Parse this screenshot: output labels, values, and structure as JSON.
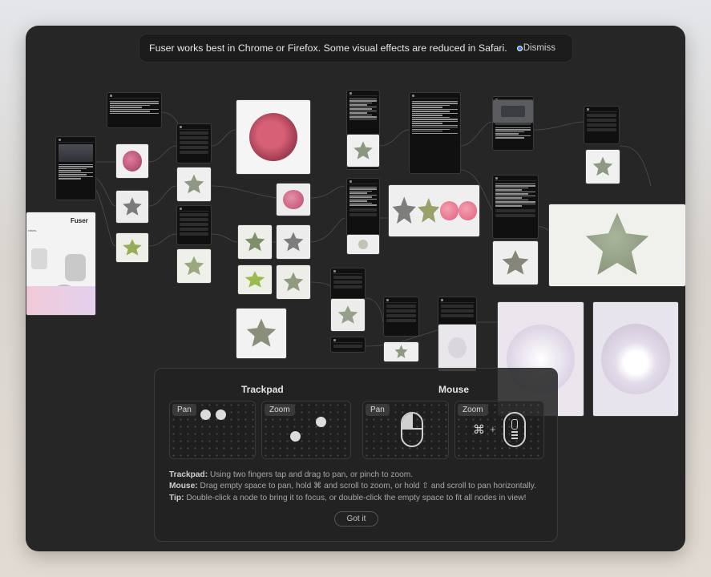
{
  "banner": {
    "message": "Fuser works best in Chrome or Firefox. Some visual effects are reduced in Safari.",
    "icons": [
      "chrome-icon",
      "firefox-icon"
    ],
    "dismiss_label": "Dismiss"
  },
  "canvas": {
    "landing_card": {
      "brand": "Fuser",
      "snippet": "rators."
    }
  },
  "help": {
    "trackpad_title": "Trackpad",
    "mouse_title": "Mouse",
    "pan_label": "Pan",
    "zoom_label": "Zoom",
    "cmd_symbol": "⌘",
    "plus_symbol": "+",
    "tips": [
      {
        "label": "Trackpad:",
        "text": " Using two fingers tap and drag to pan, or pinch to zoom."
      },
      {
        "label": "Mouse:",
        "text": " Drag empty space to pan, hold ⌘ and scroll to zoom, or hold ⇧ and scroll to pan horizontally."
      },
      {
        "label": "Tip:",
        "text": " Double-click a node to bring it to focus, or double-click the empty space to fit all nodes in view!"
      }
    ],
    "got_it_label": "Got it"
  },
  "colors": {
    "canvas_bg": "#262626",
    "sage": "#8d9a80",
    "pink": "#d9587a",
    "magenta": "#b0445f",
    "white_ceramic": "#e9e6ec"
  }
}
